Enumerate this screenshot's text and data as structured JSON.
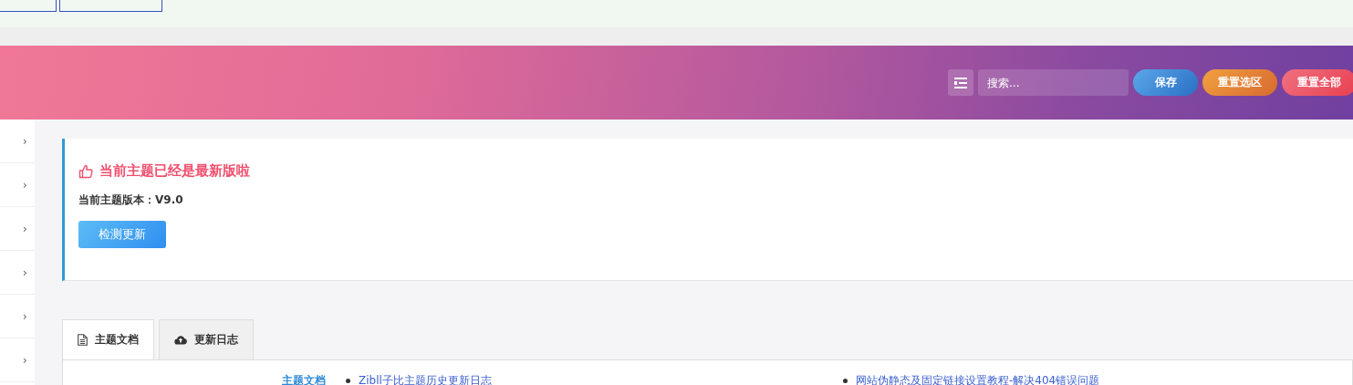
{
  "header": {
    "search": {
      "placeholder": "搜索..."
    },
    "buttons": [
      {
        "label": "保存",
        "kind": "save"
      },
      {
        "label": "重置选区",
        "kind": "reset-section"
      },
      {
        "label": "重置全部",
        "kind": "reset-all"
      }
    ]
  },
  "sidebar": {
    "items": [
      {
        "chevron": "›"
      },
      {
        "chevron": "›"
      },
      {
        "chevron": "›"
      },
      {
        "chevron": "›"
      },
      {
        "chevron": "›"
      },
      {
        "chevron": "›"
      }
    ]
  },
  "notice": {
    "title": "当前主题已经是最新版啦",
    "version_label": "当前主题版本：",
    "version": "V9.0",
    "button": "检测更新"
  },
  "tabs": [
    {
      "label": "主题文档",
      "kind": "docs",
      "selected": true
    },
    {
      "label": "更新日志",
      "kind": "changelog",
      "selected": false
    }
  ],
  "docs": {
    "heading": "主题文档",
    "links": [
      "Zibll子比主题历史更新日志",
      "网站伪静态及固定链接设置教程-解决404错误问题"
    ]
  }
}
